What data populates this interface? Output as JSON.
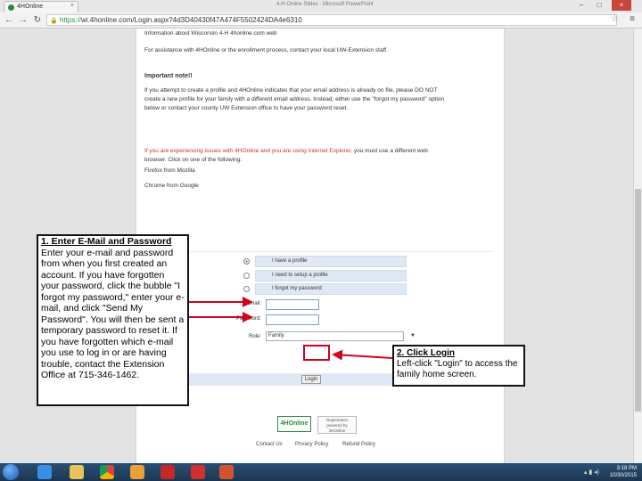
{
  "browser": {
    "tab_title": "4HOnline",
    "window_title": "4-H Online Slides - Microsoft PowerPoint",
    "url_https": "https://",
    "url_rest": "wi.4honline.com/Login.aspx?4d3D40430f47A474F5502424DA4e6310",
    "back_icon": "back-arrow-icon",
    "forward_icon": "forward-arrow-icon",
    "reload_icon": "reload-icon"
  },
  "page": {
    "line1": "Information about Wisconsin 4-H 4honline.com web",
    "line2": "For assistance with 4HOnline or the enrollment process, contact your local UW-Extension staff.",
    "important_heading": "Important note!!",
    "important_body_1": "If you attempt to create a profile and 4HOnline indicates that your email address is already on file, please DO NOT",
    "important_body_2": "create a new profile for your family with a different email address. Instead, either use the \"forgot my password\" option",
    "important_body_3": "below or contact your county UW Extension office to have your password reset.",
    "ie_warning_red": "If you are experiencing issues with 4HOnline and you are using Internet Explorer,",
    "ie_warning_rest": " you must use a different web",
    "ie_warning_line2": "browser.  Click on one of the following:",
    "firefox_link": "Firefox from Mozilla",
    "chrome_link": "Chrome from Google"
  },
  "login": {
    "radio_options": [
      "I have a profile",
      "I need to setup a profile",
      "I forgot my password"
    ],
    "selected_radio": 0,
    "email_label": "Email:",
    "password_label": "Password:",
    "role_label": "Role:",
    "role_value": "Family",
    "login_button": "Login"
  },
  "footer": {
    "logo_text": "4HOnline",
    "registration_badge": "Registration powered by 4HOnline",
    "links": [
      "Contact Us",
      "Privacy Policy",
      "Refund Policy"
    ]
  },
  "callout1": {
    "title": "1. Enter E-Mail and Password",
    "body": "Enter your e-mail and password from when you first created an account. If you have forgotten your password, click the bubble \"I forgot my password,\" enter your e-mail, and click \"Send My Password\". You will then be sent a temporary password to reset it. If you have forgotten which e-mail you use to log in or are having trouble, contact the Extension Office at 715-346-1462."
  },
  "callout2": {
    "title": "2. Click Login",
    "body": "Left-click \"Login\" to access the family home screen."
  },
  "taskbar": {
    "time": "3:18 PM",
    "date": "10/30/2015",
    "apps": [
      "internet-explorer-icon",
      "file-explorer-icon",
      "chrome-icon",
      "paint-icon",
      "acrobat-icon",
      "acrobat-reader-icon",
      "powerpoint-icon"
    ]
  },
  "colors": {
    "annotation_red": "#d0021b",
    "warning_red": "#c0392b",
    "brand_green": "#2e8b3d",
    "form_blue": "#dfe9f5"
  }
}
